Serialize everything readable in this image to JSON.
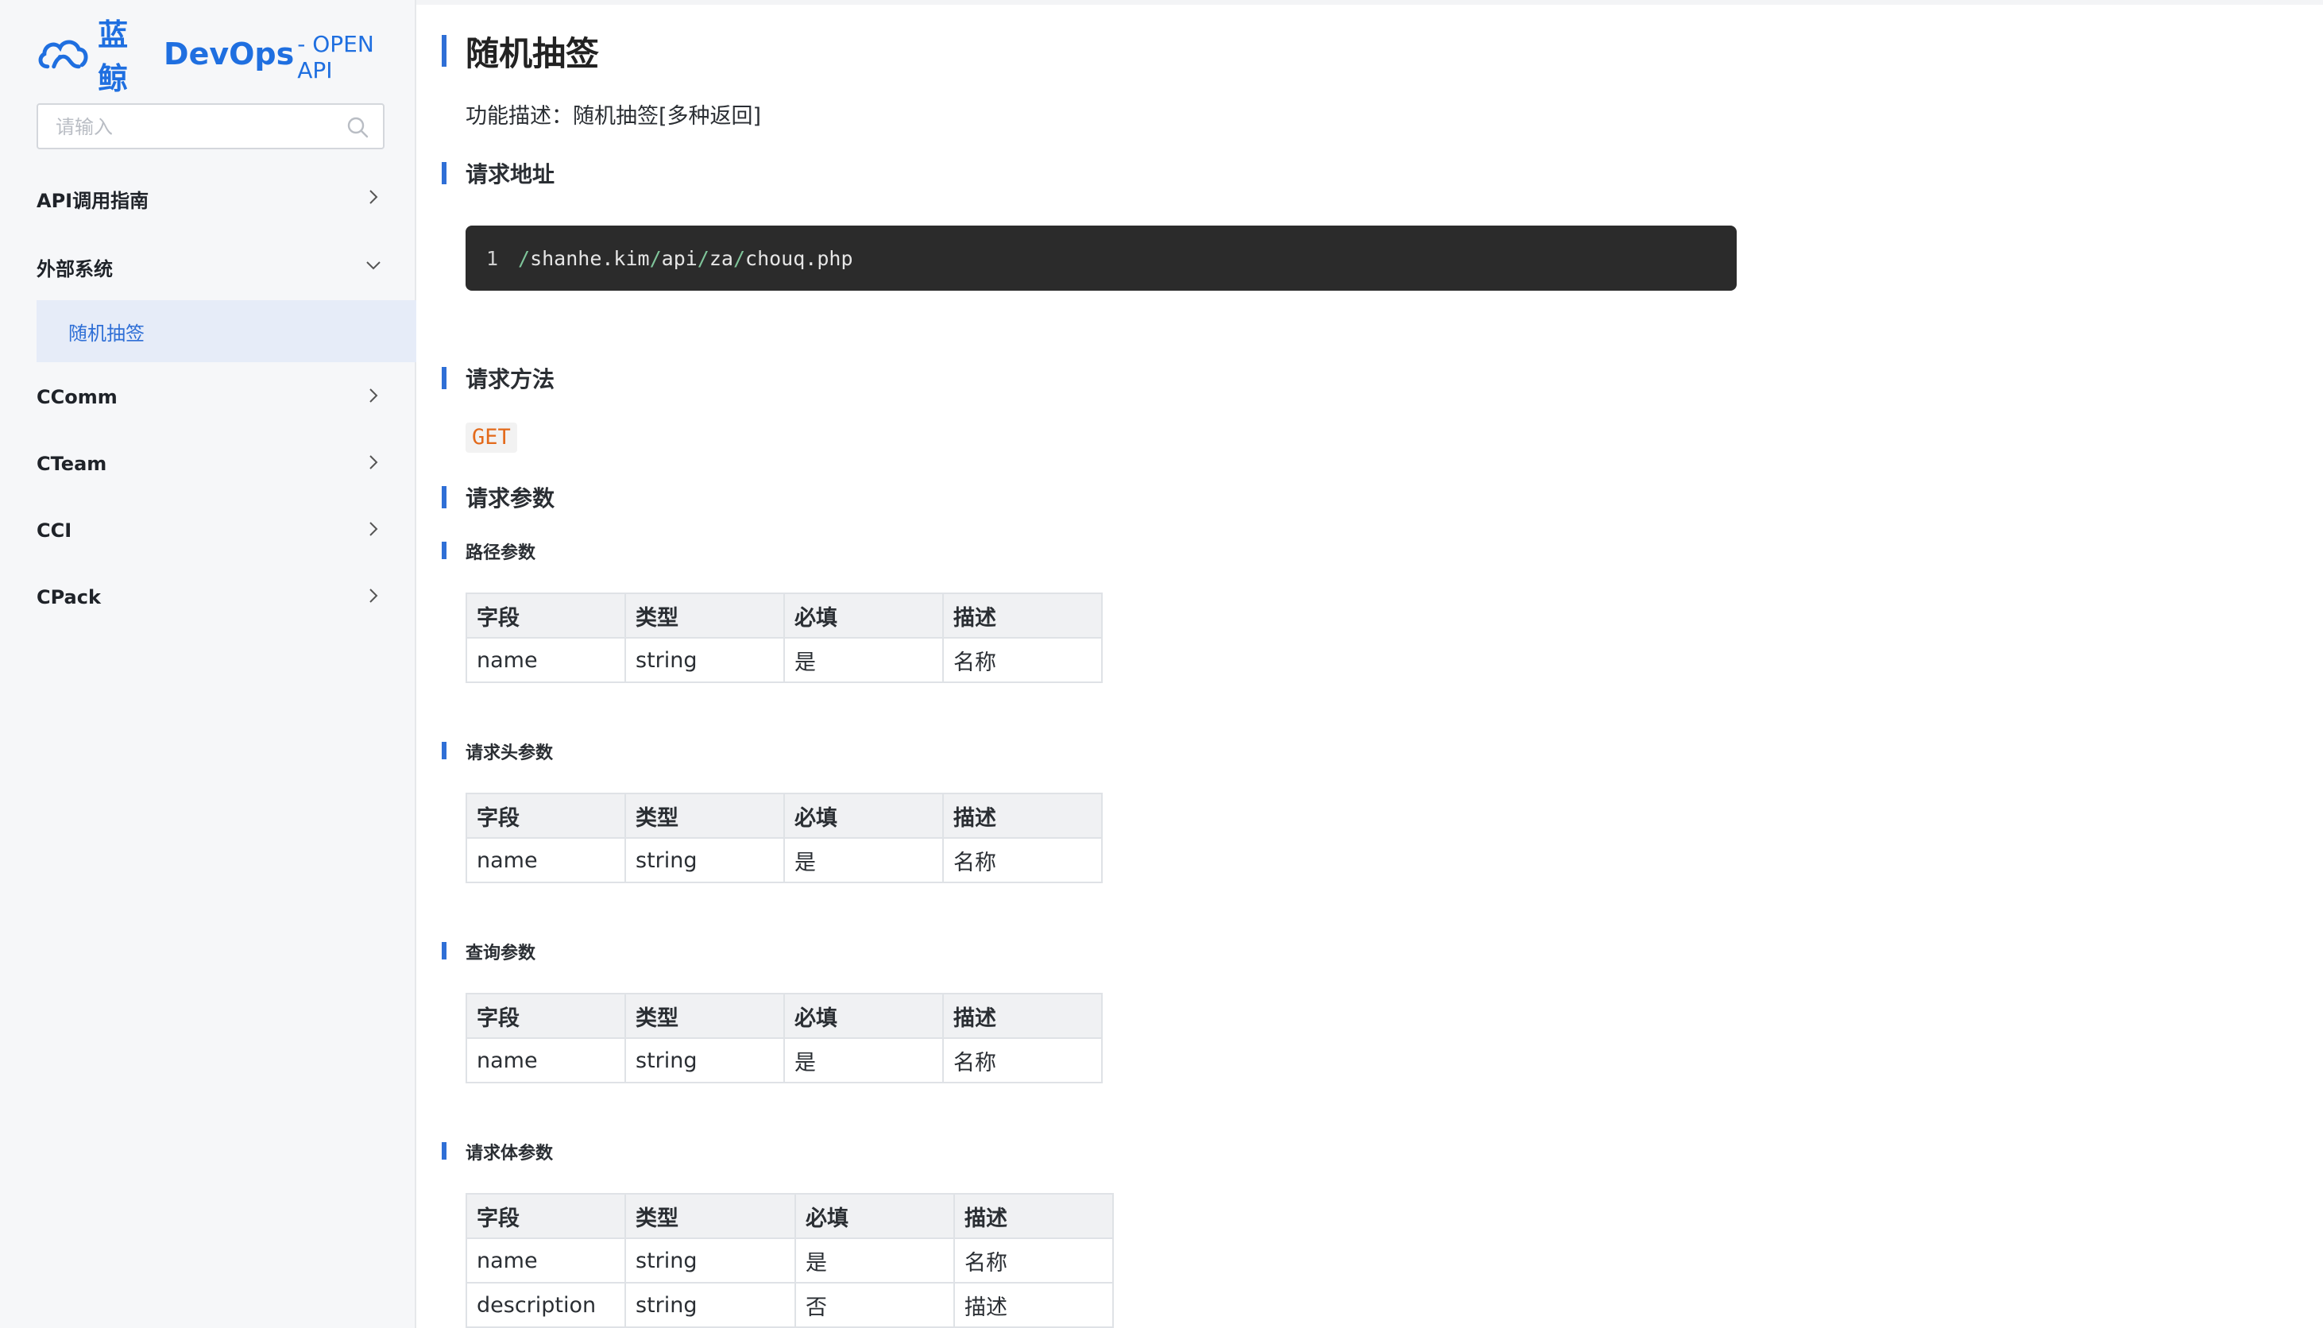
{
  "brand": {
    "name_cn": "蓝鲸",
    "name_en": "DevOps",
    "suffix": "- OPEN API",
    "logo_icon": "cloud-whale-icon",
    "accent_color": "#2f6fd6"
  },
  "search": {
    "placeholder": "请输入",
    "value": ""
  },
  "sidebar": {
    "items": [
      {
        "label": "API调用指南",
        "icon": "chevron-right-icon"
      },
      {
        "label": "外部系统",
        "icon": "chevron-down-icon"
      },
      {
        "label": "CComm",
        "icon": "chevron-right-icon"
      },
      {
        "label": "CTeam",
        "icon": "chevron-right-icon"
      },
      {
        "label": "CCI",
        "icon": "chevron-right-icon"
      },
      {
        "label": "CPack",
        "icon": "chevron-right-icon"
      }
    ],
    "active_sub": {
      "label": "随机抽签"
    }
  },
  "doc": {
    "title": "随机抽签",
    "description": "功能描述：随机抽签[多种返回]",
    "sections": {
      "url": "请求地址",
      "method": "请求方法",
      "params": "请求参数"
    },
    "url": {
      "line": "1",
      "segments": [
        "/",
        "shanhe.kim",
        "/",
        "api",
        "/",
        "za",
        "/",
        "chouq.php"
      ]
    },
    "method": "GET",
    "tables": [
      {
        "title": "路径参数",
        "headers": [
          "字段",
          "类型",
          "必填",
          "描述"
        ],
        "rows": [
          [
            "name",
            "string",
            "是",
            "名称"
          ]
        ]
      },
      {
        "title": "请求头参数",
        "headers": [
          "字段",
          "类型",
          "必填",
          "描述"
        ],
        "rows": [
          [
            "name",
            "string",
            "是",
            "名称"
          ]
        ]
      },
      {
        "title": "查询参数",
        "headers": [
          "字段",
          "类型",
          "必填",
          "描述"
        ],
        "rows": [
          [
            "name",
            "string",
            "是",
            "名称"
          ]
        ]
      },
      {
        "title": "请求体参数",
        "headers": [
          "字段",
          "类型",
          "必填",
          "描述"
        ],
        "rows": [
          [
            "name",
            "string",
            "是",
            "名称"
          ],
          [
            "description",
            "string",
            "否",
            "描述"
          ]
        ]
      }
    ]
  }
}
